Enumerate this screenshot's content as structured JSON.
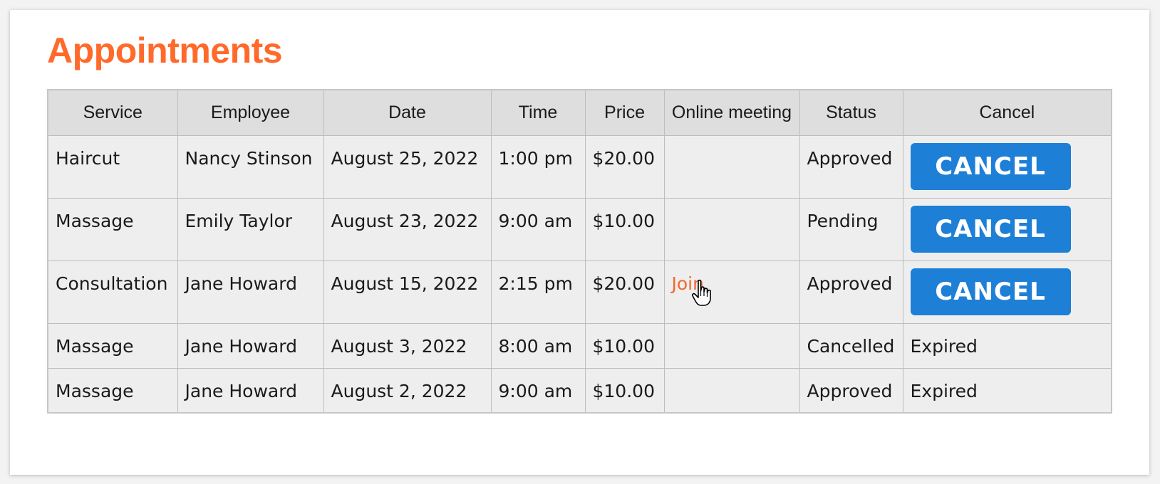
{
  "page": {
    "title": "Appointments"
  },
  "table": {
    "columns": [
      "Service",
      "Employee",
      "Date",
      "Time",
      "Price",
      "Online meeting",
      "Status",
      "Cancel"
    ],
    "rows": [
      {
        "service": "Haircut",
        "employee": "Nancy Stinson",
        "date": "August 25, 2022",
        "time": "1:00 pm",
        "price": "$20.00",
        "meeting": "",
        "status": "Approved",
        "cancel": "CANCEL"
      },
      {
        "service": "Massage",
        "employee": "Emily Taylor",
        "date": "August 23, 2022",
        "time": "9:00 am",
        "price": "$10.00",
        "meeting": "",
        "status": "Pending",
        "cancel": "CANCEL"
      },
      {
        "service": "Consultation",
        "employee": "Jane Howard",
        "date": "August 15, 2022",
        "time": "2:15 pm",
        "price": "$20.00",
        "meeting": "Join",
        "status": "Approved",
        "cancel": "CANCEL"
      },
      {
        "service": "Massage",
        "employee": "Jane Howard",
        "date": "August 3, 2022",
        "time": "8:00 am",
        "price": "$10.00",
        "meeting": "",
        "status": "Cancelled",
        "cancel": "Expired"
      },
      {
        "service": "Massage",
        "employee": "Jane Howard",
        "date": "August 2, 2022",
        "time": "9:00 am",
        "price": "$10.00",
        "meeting": "",
        "status": "Approved",
        "cancel": "Expired"
      }
    ]
  },
  "icons": {
    "cursor": "hand-pointer-icon"
  },
  "colors": {
    "title": "#ff6a2b",
    "button": "#1e7fd7",
    "link": "#f06a2e",
    "header_bg": "#dedede",
    "cell_bg": "#eeeeee"
  }
}
